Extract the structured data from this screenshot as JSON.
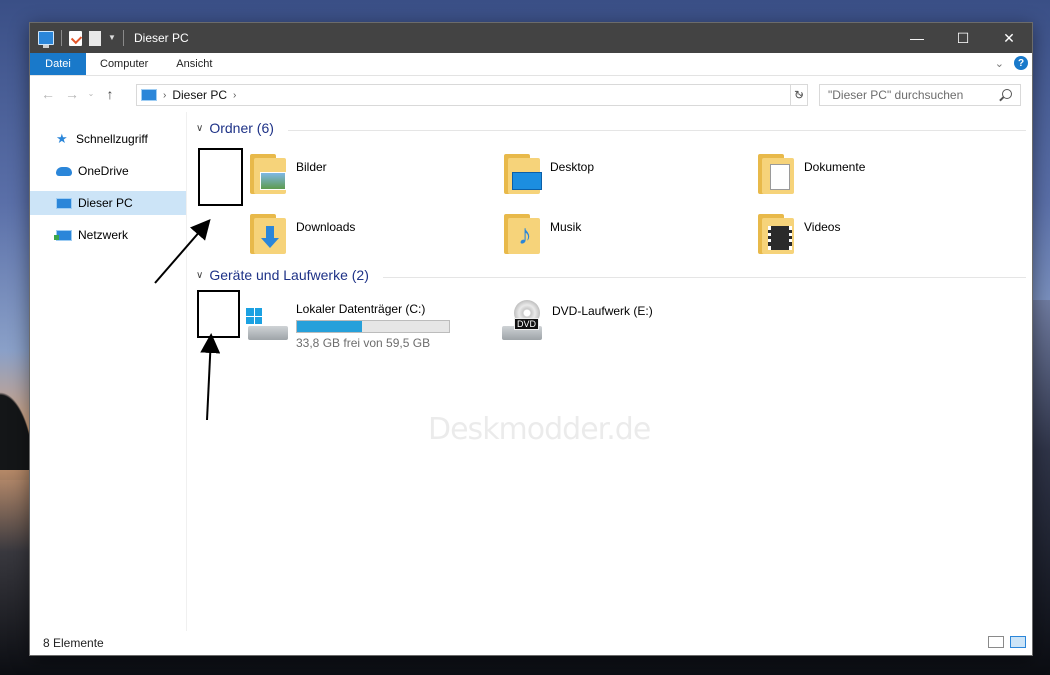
{
  "window": {
    "title": "Dieser PC",
    "controls": {
      "minimize": "—",
      "maximize": "☐",
      "close": "✕"
    }
  },
  "ribbon": {
    "tabs": [
      "Datei",
      "Computer",
      "Ansicht"
    ]
  },
  "navigation": {
    "back": "←",
    "forward": "→",
    "recent": "⌄",
    "up": "↑",
    "address_path": "Dieser PC",
    "refresh": "↻",
    "search_placeholder": "\"Dieser PC\" durchsuchen"
  },
  "sidebar": {
    "items": [
      {
        "label": "Schnellzugriff",
        "icon": "star-icon"
      },
      {
        "label": "OneDrive",
        "icon": "cloud-icon"
      },
      {
        "label": "Dieser PC",
        "icon": "pc-icon",
        "selected": true
      },
      {
        "label": "Netzwerk",
        "icon": "network-icon"
      }
    ]
  },
  "groups": {
    "folders": {
      "header": "Ordner (6)",
      "items": [
        {
          "label": "Bilder",
          "icon": "pictures-folder-icon"
        },
        {
          "label": "Desktop",
          "icon": "desktop-folder-icon"
        },
        {
          "label": "Dokumente",
          "icon": "documents-folder-icon"
        },
        {
          "label": "Downloads",
          "icon": "downloads-folder-icon"
        },
        {
          "label": "Musik",
          "icon": "music-folder-icon"
        },
        {
          "label": "Videos",
          "icon": "videos-folder-icon"
        }
      ]
    },
    "drives": {
      "header": "Geräte und Laufwerke (2)",
      "items": [
        {
          "label": "Lokaler Datenträger (C:)",
          "free_text": "33,8 GB frei von 59,5 GB",
          "used_fraction": 0.43,
          "icon": "hard-drive-icon"
        },
        {
          "label": "DVD-Laufwerk (E:)",
          "tag": "DVD",
          "icon": "dvd-drive-icon"
        }
      ]
    }
  },
  "watermark": "Deskmodder.de",
  "status": {
    "count": "8 Elemente"
  },
  "colors": {
    "accent": "#1979ca",
    "selection": "#cce4f7",
    "group_header": "#1e3287",
    "drive_bar": "#26a0da"
  }
}
